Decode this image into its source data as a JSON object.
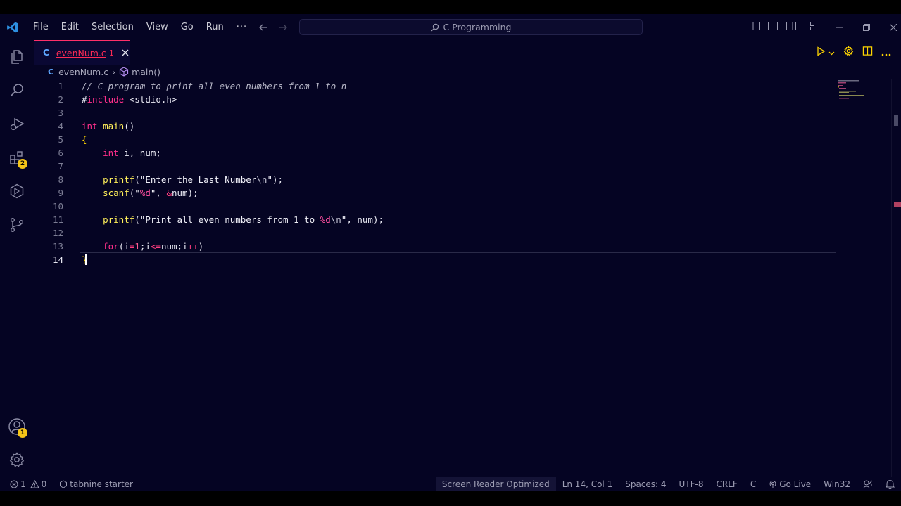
{
  "app": {
    "command_center": "C Programming",
    "menu": [
      "File",
      "Edit",
      "Selection",
      "View",
      "Go",
      "Run",
      "···"
    ]
  },
  "activity_badges": {
    "extensions": "2",
    "accounts": "1"
  },
  "tab": {
    "lang": "C",
    "name": "evenNum.c",
    "count": "1"
  },
  "breadcrumb": {
    "lang": "C",
    "file": "evenNum.c",
    "sep": "›",
    "symbol": "main()"
  },
  "editor": {
    "line_numbers": [
      "1",
      "2",
      "3",
      "4",
      "5",
      "6",
      "7",
      "8",
      "9",
      "10",
      "11",
      "12",
      "13",
      "14"
    ],
    "active_line": "14"
  },
  "status": {
    "errors": "1",
    "warnings": "0",
    "tabnine": "tabnine starter",
    "screen_reader": "Screen Reader Optimized",
    "position": "Ln 14, Col 1",
    "spaces": "Spaces: 4",
    "encoding": "UTF-8",
    "eol": "CRLF",
    "language": "C",
    "go_live": "Go Live",
    "platform": "Win32"
  },
  "colors": {
    "background": "#050423",
    "accent": "#ff2f6a",
    "keyword": "#ff2f8a",
    "function": "#ffef5a",
    "badge": "#f5c518"
  }
}
